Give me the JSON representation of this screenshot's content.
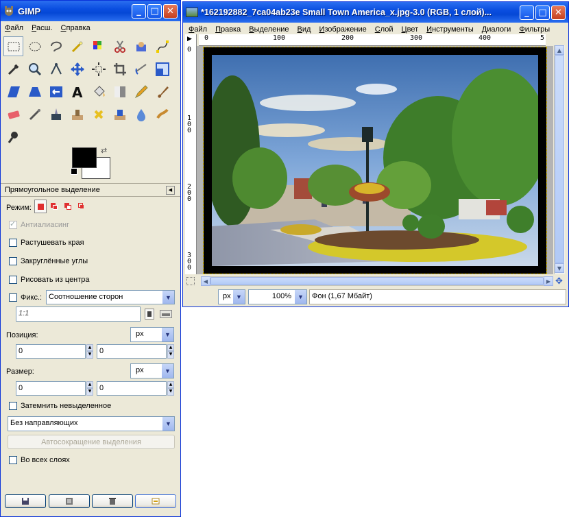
{
  "toolbox": {
    "title": "GIMP",
    "menu": [
      "Файл",
      "Расш.",
      "Справка"
    ],
    "tool_icons": [
      "rect-select-icon",
      "ellipse-select-icon",
      "lasso-icon",
      "fuzzy-select-icon",
      "color-select-icon",
      "scissors-icon",
      "foreground-select-icon",
      "paths-icon",
      "color-picker-icon",
      "zoom-icon",
      "measure-icon",
      "move-icon",
      "align-icon",
      "crop-icon",
      "rotate-icon",
      "scale-icon",
      "shear-icon",
      "perspective-icon",
      "flip-icon",
      "text-icon",
      "bucket-fill-icon",
      "blend-icon",
      "pencil-icon",
      "paintbrush-icon",
      "eraser-icon",
      "airbrush-icon",
      "ink-icon",
      "clone-icon",
      "heal-icon",
      "perspective-clone-icon",
      "blur-icon",
      "smudge-icon",
      "dodge-burn-icon"
    ]
  },
  "tool_options": {
    "title": "Прямоугольное выделение",
    "mode_label": "Режим:",
    "antialias": "Антиалиасинг",
    "feather": "Растушевать края",
    "rounded": "Закруглённые углы",
    "center": "Рисовать из центра",
    "fixed_label": "Фикс.:",
    "fixed_option": "Соотношение сторон",
    "ratio_value": "1:1",
    "position_label": "Позиция:",
    "position_unit": "px",
    "pos_x": "0",
    "pos_y": "0",
    "size_label": "Размер:",
    "size_unit": "px",
    "size_w": "0",
    "size_h": "0",
    "shade": "Затемнить невыделенное",
    "guides": "Без направляющих",
    "autoshrink": "Автосокращение выделения",
    "all_layers": "Во всех слоях"
  },
  "image_window": {
    "title": "*162192882_7ca04ab23e Small Town America_x.jpg-3.0 (RGB, 1 слой)...",
    "menu": [
      "Файл",
      "Правка",
      "Выделение",
      "Вид",
      "Изображение",
      "Слой",
      "Цвет",
      "Инструменты",
      "Диалоги",
      "Фильтры"
    ],
    "ruler_h": [
      "0",
      "100",
      "200",
      "300",
      "400",
      "5"
    ],
    "ruler_v": [
      "0",
      "1\n0\n0",
      "2\n0\n0",
      "3\n0\n0"
    ],
    "unit": "px",
    "zoom": "100%",
    "status": "Фон (1,67 Мбайт)"
  }
}
